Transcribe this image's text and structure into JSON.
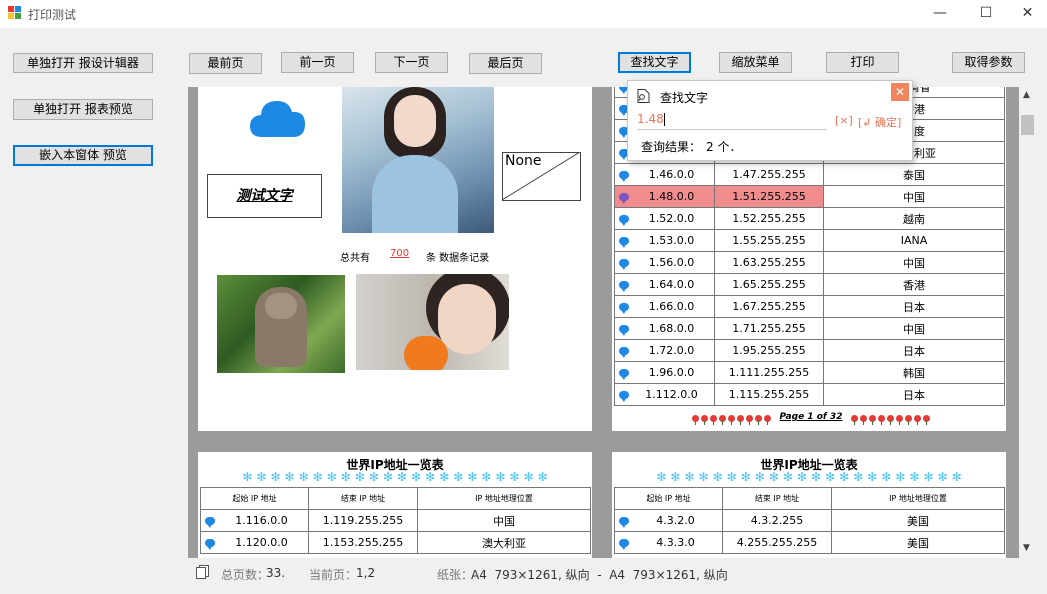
{
  "window": {
    "title": "打印测试",
    "minimize": "—",
    "maximize": "☐",
    "close": "✕"
  },
  "left_buttons": [
    "单独打开 报设计辑器",
    "单独打开 报表预览",
    "嵌入本窗体 预览"
  ],
  "toolbar": {
    "first": "最前页",
    "prev": "前一页",
    "next": "下一页",
    "last": "最后页",
    "find": "查找文字",
    "zoom_menu": "缩放菜单",
    "print": "打印",
    "params": "取得参数"
  },
  "find_popup": {
    "title": "查找文字",
    "search_value": "1.48",
    "clear_label": "[×]",
    "ok_label": "[↲ 确定]",
    "result_label": "查询结果：",
    "result_value": "2 个．"
  },
  "page1": {
    "test_text": "测试文字",
    "none_label": "None",
    "total_prefix": "总共有",
    "total_count": "700",
    "total_suffix": "条 数据条记录"
  },
  "page2": {
    "partial_rows": [
      {
        "loc": "台湾省"
      },
      {
        "loc": "香港"
      },
      {
        "loc": "印度"
      },
      {
        "loc": "澳大利亚"
      }
    ],
    "rows": [
      {
        "start": "1.46.0.0",
        "end": "1.47.255.255",
        "loc": "泰国"
      },
      {
        "start": "1.48.0.0",
        "end": "1.51.255.255",
        "loc": "中国"
      },
      {
        "start": "1.52.0.0",
        "end": "1.52.255.255",
        "loc": "越南"
      },
      {
        "start": "1.53.0.0",
        "end": "1.55.255.255",
        "loc": "IANA"
      },
      {
        "start": "1.56.0.0",
        "end": "1.63.255.255",
        "loc": "中国"
      },
      {
        "start": "1.64.0.0",
        "end": "1.65.255.255",
        "loc": "香港"
      },
      {
        "start": "1.66.0.0",
        "end": "1.67.255.255",
        "loc": "日本"
      },
      {
        "start": "1.68.0.0",
        "end": "1.71.255.255",
        "loc": "中国"
      },
      {
        "start": "1.72.0.0",
        "end": "1.95.255.255",
        "loc": "日本"
      },
      {
        "start": "1.96.0.0",
        "end": "1.111.255.255",
        "loc": "韩国"
      },
      {
        "start": "1.112.0.0",
        "end": "1.115.255.255",
        "loc": "日本"
      }
    ],
    "footer": "Page 1 of 32"
  },
  "page3": {
    "title": "世界IP地址一览表",
    "headers": [
      "起始 IP 地址",
      "结束 IP 地址",
      "IP 地址地理位置"
    ],
    "rows": [
      {
        "start": "1.116.0.0",
        "end": "1.119.255.255",
        "loc": "中国"
      },
      {
        "start": "1.120.0.0",
        "end": "1.153.255.255",
        "loc": "澳大利亚"
      }
    ]
  },
  "page4": {
    "title": "世界IP地址一览表",
    "headers": [
      "起始 IP 地址",
      "结束 IP 地址",
      "IP 地址地理位置"
    ],
    "rows": [
      {
        "start": "4.3.2.0",
        "end": "4.3.2.255",
        "loc": "美国"
      },
      {
        "start": "4.3.3.0",
        "end": "4.255.255.255",
        "loc": "美国"
      }
    ]
  },
  "status": {
    "total_label": "总页数：",
    "total_value": "33.",
    "current_label": "当前页：",
    "current_value": "1,2",
    "paper_label": "纸张：",
    "paper_value": "A4  793×1261, 纵向  -  A4  793×1261, 纵向"
  },
  "colors": {
    "highlight": "#f08c8c",
    "accent": "#0078d7",
    "bubble": "#1e88e5",
    "close_btn": "#f0845c"
  }
}
